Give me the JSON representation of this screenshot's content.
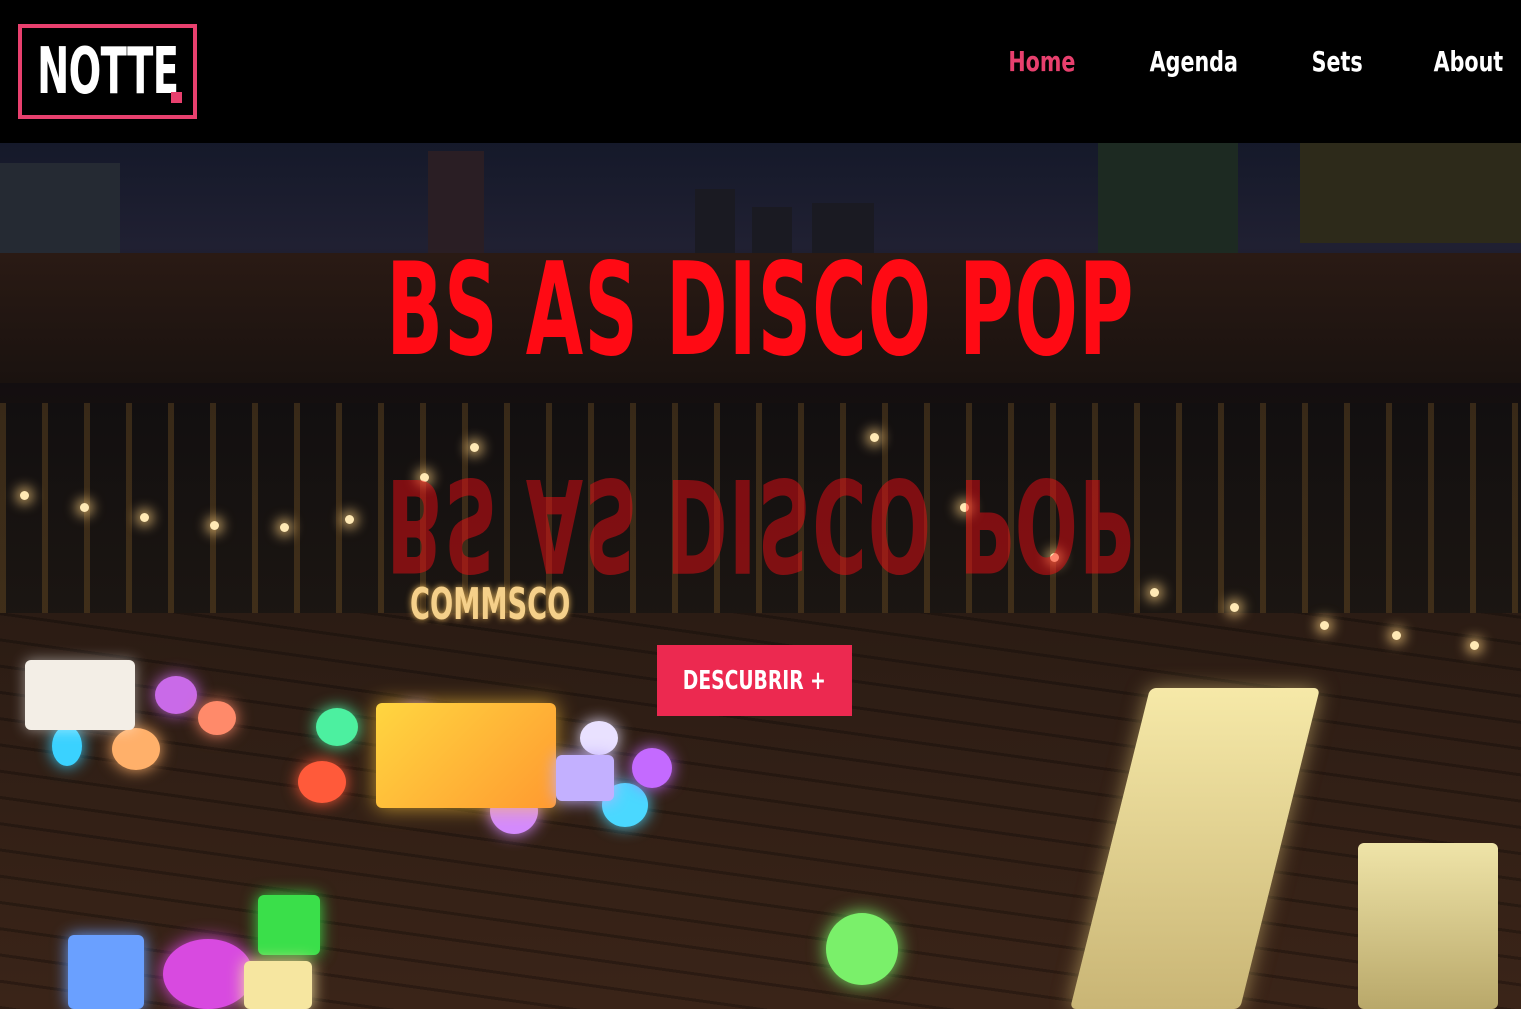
{
  "header": {
    "logo_text": "NOTTE",
    "nav": [
      {
        "label": "Home",
        "active": true
      },
      {
        "label": "Agenda",
        "active": false
      },
      {
        "label": "Sets",
        "active": false
      },
      {
        "label": "About",
        "active": false
      }
    ]
  },
  "hero": {
    "title": "BS AS DISCO POP",
    "title_reflection": "BS AS DISCO POP",
    "cta_label": "DESCUBRIR +",
    "photo_sign_text": "COMMSCO"
  },
  "colors": {
    "accent": "#e8406e",
    "title_red": "#ff0a14",
    "cta_bg": "#ec2950",
    "header_bg": "#000000"
  }
}
